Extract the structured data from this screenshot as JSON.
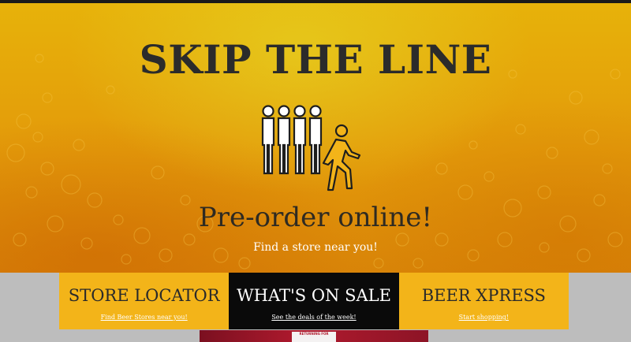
{
  "hero": {
    "title": "SKIP THE LINE",
    "subtitle": "Pre-order online!",
    "link": "Find a store near you!",
    "icon": "queue-skip-icon"
  },
  "cards": [
    {
      "title": "STORE LOCATOR",
      "link": "Find Beer Stores near you!",
      "bg": "#f3b419"
    },
    {
      "title": "WHAT'S ON SALE",
      "link": "See the deals of the week!",
      "bg": "#0a0a0a"
    },
    {
      "title": "BEER XPRESS",
      "link": "Start shopping!",
      "bg": "#f3b419"
    }
  ],
  "banner": {
    "tag": "RETURNING FOR"
  },
  "colors": {
    "accent": "#f3b419",
    "dark": "#0a0a0a",
    "hero": "#e39a0a"
  }
}
